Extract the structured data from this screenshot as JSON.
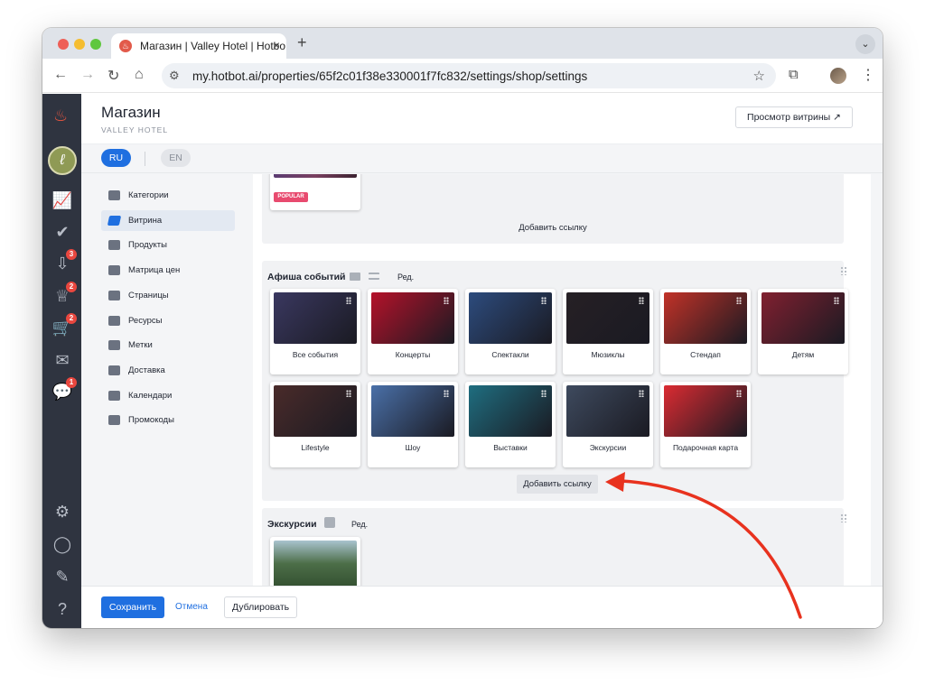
{
  "browser": {
    "tab_title": "Магазин | Valley Hotel | Hotbo",
    "url": "my.hotbot.ai/properties/65f2c01f38e330001f7fc832/settings/shop/settings"
  },
  "rail": {
    "badges": {
      "inbox": "3",
      "service": "2",
      "cart": "2",
      "chat": "1"
    }
  },
  "header": {
    "title": "Магазин",
    "subtitle": "VALLEY HOTEL",
    "preview_button": "Просмотр витрины ↗"
  },
  "languages": {
    "ru": "RU",
    "en": "EN"
  },
  "nav": {
    "items": [
      {
        "label": "Категории"
      },
      {
        "label": "Витрина"
      },
      {
        "label": "Продукты"
      },
      {
        "label": "Матрица цен"
      },
      {
        "label": "Страницы"
      },
      {
        "label": "Ресурсы"
      },
      {
        "label": "Метки"
      },
      {
        "label": "Доставка"
      },
      {
        "label": "Календари"
      },
      {
        "label": "Промокоды"
      }
    ],
    "active_index": 1
  },
  "sections": {
    "top": {
      "badge": "POPULAR",
      "add_link": "Добавить ссылку"
    },
    "events": {
      "title": "Афиша событий",
      "edit": "Ред.",
      "cards": [
        {
          "label": "Все события",
          "color": "#3a3860"
        },
        {
          "label": "Концерты",
          "color": "#b5122a"
        },
        {
          "label": "Спектакли",
          "color": "#2d4c7e"
        },
        {
          "label": "Мюзиклы",
          "color": "#262025"
        },
        {
          "label": "Стендап",
          "color": "#c23228"
        },
        {
          "label": "Детям",
          "color": "#812030"
        },
        {
          "label": "Lifestyle",
          "color": "#4a2b2a"
        },
        {
          "label": "Шоу",
          "color": "#4a70a8"
        },
        {
          "label": "Выставки",
          "color": "#1f6e80"
        },
        {
          "label": "Экскурсии",
          "color": "#3e4a5e"
        },
        {
          "label": "Подарочная карта",
          "color": "#db2b32"
        }
      ],
      "add_link": "Добавить ссылку"
    },
    "excursions": {
      "title": "Экскурсии",
      "edit": "Ред.",
      "card_color": "#4c6e48"
    }
  },
  "footer": {
    "save": "Сохранить",
    "cancel": "Отмена",
    "duplicate": "Дублировать"
  },
  "colors": {
    "accent": "#1f6fe0",
    "annotation_arrow": "#e8321e"
  }
}
